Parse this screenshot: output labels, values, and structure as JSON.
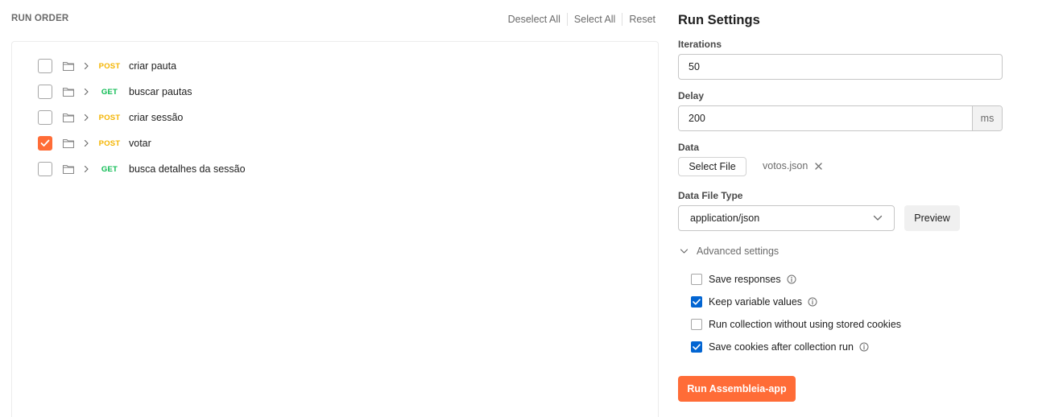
{
  "run_order": {
    "title": "RUN ORDER",
    "actions": {
      "deselect_all": "Deselect All",
      "select_all": "Select All",
      "reset": "Reset"
    },
    "requests": [
      {
        "method": "POST",
        "name": "criar pauta",
        "checked": false
      },
      {
        "method": "GET",
        "name": "buscar pautas",
        "checked": false
      },
      {
        "method": "POST",
        "name": "criar sessão",
        "checked": false
      },
      {
        "method": "POST",
        "name": "votar",
        "checked": true
      },
      {
        "method": "GET",
        "name": "busca detalhes da sessão",
        "checked": false
      }
    ]
  },
  "settings": {
    "title": "Run Settings",
    "iterations": {
      "label": "Iterations",
      "value": "50"
    },
    "delay": {
      "label": "Delay",
      "value": "200",
      "unit": "ms"
    },
    "data": {
      "label": "Data",
      "select_button": "Select File",
      "file_name": "votos.json"
    },
    "data_file_type": {
      "label": "Data File Type",
      "value": "application/json",
      "preview_button": "Preview"
    },
    "advanced": {
      "label": "Advanced settings",
      "options": [
        {
          "label": "Save responses",
          "checked": false,
          "info": true
        },
        {
          "label": "Keep variable values",
          "checked": true,
          "info": true
        },
        {
          "label": "Run collection without using stored cookies",
          "checked": false,
          "info": false
        },
        {
          "label": "Save cookies after collection run",
          "checked": true,
          "info": true
        }
      ]
    },
    "run_button": "Run Assembleia-app"
  },
  "colors": {
    "accent": "#ff6c37",
    "post": "#f4b400",
    "get": "#0cbb52",
    "checkbox_blue": "#0265d2"
  }
}
